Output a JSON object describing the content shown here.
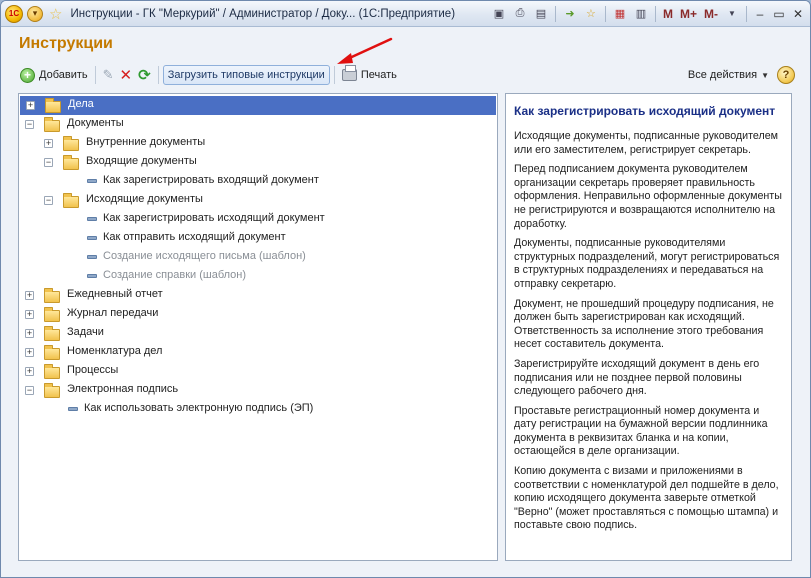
{
  "window": {
    "title": "Инструкции - ГК \"Меркурий\" / Администратор / Доку...  (1С:Предприятие)",
    "logo_text": "1С",
    "toolbar_icons": [
      "save-icon",
      "print-icon",
      "preview-icon",
      "go-icon",
      "favorites-icon",
      "calendar-icon",
      "calculator-icon"
    ],
    "memory_buttons": [
      "M",
      "M+",
      "M-"
    ],
    "window_buttons": [
      "minimize-icon",
      "restore-icon",
      "close-icon"
    ]
  },
  "page_title": "Инструкции",
  "toolbar": {
    "add_label": "Добавить",
    "load_label": "Загрузить типовые инструкции",
    "print_label": "Печать",
    "all_actions_label": "Все действия",
    "help_label": "?"
  },
  "tree": [
    {
      "label": "Дела",
      "level": 0,
      "type": "folder",
      "expander": "+",
      "selected": true
    },
    {
      "label": "Документы",
      "level": 0,
      "type": "folder",
      "expander": "-"
    },
    {
      "label": "Внутренние документы",
      "level": 1,
      "type": "folder",
      "expander": "+"
    },
    {
      "label": "Входящие документы",
      "level": 1,
      "type": "folder",
      "expander": "-"
    },
    {
      "label": "Как зарегистрировать входящий документ",
      "level": 2,
      "type": "doc"
    },
    {
      "label": "Исходящие документы",
      "level": 1,
      "type": "folder",
      "expander": "-"
    },
    {
      "label": "Как зарегистрировать исходящий документ",
      "level": 2,
      "type": "doc"
    },
    {
      "label": "Как отправить исходящий документ",
      "level": 2,
      "type": "doc"
    },
    {
      "label": "Создание исходящего письма (шаблон)",
      "level": 2,
      "type": "doc",
      "grey": true
    },
    {
      "label": "Создание справки (шаблон)",
      "level": 2,
      "type": "doc",
      "grey": true
    },
    {
      "label": "Ежедневный отчет",
      "level": 0,
      "type": "folder",
      "expander": "+"
    },
    {
      "label": "Журнал передачи",
      "level": 0,
      "type": "folder",
      "expander": "+"
    },
    {
      "label": "Задачи",
      "level": 0,
      "type": "folder",
      "expander": "+"
    },
    {
      "label": "Номенклатура дел",
      "level": 0,
      "type": "folder",
      "expander": "+"
    },
    {
      "label": "Процессы",
      "level": 0,
      "type": "folder",
      "expander": "+"
    },
    {
      "label": "Электронная подпись",
      "level": 0,
      "type": "folder",
      "expander": "-"
    },
    {
      "label": "Как использовать электронную подпись (ЭП)",
      "level": 1,
      "type": "doc"
    }
  ],
  "article": {
    "title": "Как зарегистрировать исходящий документ",
    "paragraphs": [
      "Исходящие документы, подписанные руководителем или его заместителем, регистрирует секретарь.",
      "Перед подписанием документа руководителем организации секретарь проверяет правильность оформления. Неправильно оформленные документы не регистрируются и возвращаются исполнителю на доработку.",
      "Документы, подписанные руководителями структурных подразделений, могут регистрироваться в структурных подразделениях и передаваться на отправку секретарю.",
      "Документ, не прошедший процедуру подписания, не должен быть зарегистрирован как исходящий. Ответственность за исполнение этого требования несет составитель документа.",
      "Зарегистрируйте исходящий документ в день его подписания или не позднее первой половины следующего рабочего дня.",
      "Проставьте регистрационный номер документа и дату регистрации на бумажной версии подлинника документа в реквизитах бланка и на копии, остающейся в деле организации.",
      "Копию документа с визами и приложениями в соответствии с номенклатурой дел подшейте в дело, копию исходящего документа заверьте отметкой \"Верно\" (может проставляться с помощью штампа) и поставьте свою подпись."
    ]
  },
  "colors": {
    "title_accent": "#c47a00",
    "selection": "#4a6fc4",
    "article_title": "#1a2f86",
    "annotation_arrow": "#e01010"
  }
}
